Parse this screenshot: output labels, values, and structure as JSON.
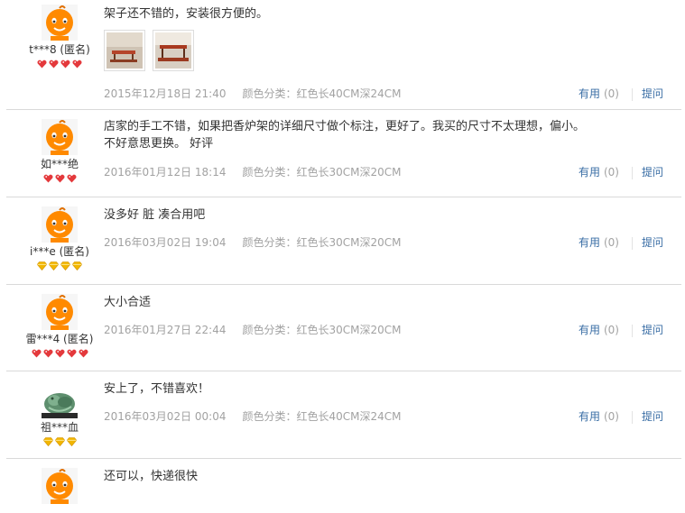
{
  "icons": {
    "avatar_default": "taobao-baby-avatar-icon",
    "avatar_jade": "jade-carving-avatar-icon",
    "rank_red": "red-heart-rank-icon",
    "rank_gold": "gold-diamond-rank-icon"
  },
  "colors": {
    "link": "#3a6ea5",
    "meta_gray": "#a2a2a2",
    "rank_red": "#e4393c",
    "rank_gold": "#f2b600"
  },
  "reviews": [
    {
      "user": "t***8 (匿名)",
      "rank": {
        "type": "red",
        "count": 4
      },
      "text": "架子还不错的，安装很方便的。",
      "photos": 2,
      "date": "2015年12月18日 21:40",
      "sku": "颜色分类：红色长40CM深24CM",
      "useful_label": "有用",
      "useful_count": "(0)",
      "reply_label": "提问"
    },
    {
      "user": "如***绝",
      "rank": {
        "type": "red",
        "count": 3
      },
      "text": "店家的手工不错，如果把香炉架的详细尺寸做个标注，更好了。我买的尺寸不太理想，偏小。不好意思更换。 好评",
      "photos": 0,
      "date": "2016年01月12日 18:14",
      "sku": "颜色分类：红色长30CM深20CM",
      "useful_label": "有用",
      "useful_count": "(0)",
      "reply_label": "提问"
    },
    {
      "user": "i***e (匿名)",
      "rank": {
        "type": "gold",
        "count": 4
      },
      "text": "没多好 脏 凑合用吧",
      "photos": 0,
      "date": "2016年03月02日 19:04",
      "sku": "颜色分类：红色长30CM深20CM",
      "useful_label": "有用",
      "useful_count": "(0)",
      "reply_label": "提问"
    },
    {
      "user": "雷***4 (匿名)",
      "rank": {
        "type": "red",
        "count": 5
      },
      "text": "大小合适",
      "photos": 0,
      "date": "2016年01月27日 22:44",
      "sku": "颜色分类：红色长30CM深20CM",
      "useful_label": "有用",
      "useful_count": "(0)",
      "reply_label": "提问"
    },
    {
      "user": "祖***血",
      "rank": {
        "type": "gold",
        "count": 3
      },
      "text": "安上了，不错喜欢！",
      "photos": 0,
      "date": "2016年03月02日 00:04",
      "sku": "颜色分类：红色长40CM深24CM",
      "useful_label": "有用",
      "useful_count": "(0)",
      "reply_label": "提问"
    },
    {
      "user": "",
      "rank": {
        "type": "none",
        "count": 0
      },
      "text": "还可以，快递很快",
      "photos": 0,
      "date": "",
      "sku": "",
      "useful_label": "",
      "useful_count": "",
      "reply_label": ""
    }
  ]
}
